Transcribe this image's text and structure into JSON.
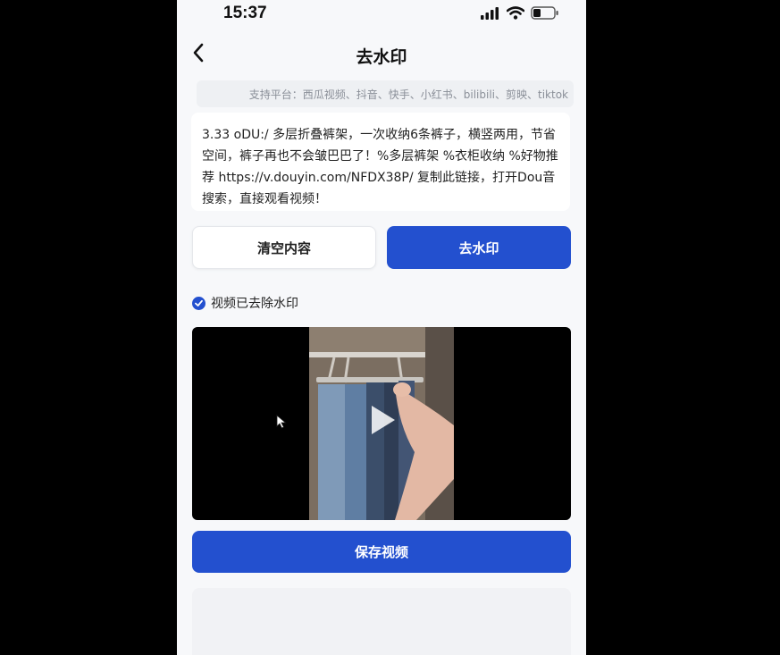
{
  "status_bar": {
    "time": "15:37",
    "icons": [
      "signal-icon",
      "wifi-icon",
      "battery-icon"
    ],
    "battery_level": 0.3
  },
  "navbar": {
    "back_icon": "chevron-left-icon",
    "title": "去水印"
  },
  "platforms_text": "支持平台：西瓜视频、抖音、快手、小红书、bilibili、剪映、tiktok",
  "input": {
    "value": "3.33 oDU:/ 多层折叠裤架，一次收纳6条裤子，横竖两用，节省空间，裤子再也不会皱巴巴了！%多层裤架 %衣柜收纳 %好物推荐 https://v.douyin.com/NFDX38P/ 复制此链接，打开Dou音搜索，直接观看视频！"
  },
  "actions": {
    "clear_label": "清空内容",
    "remove_label": "去水印"
  },
  "result": {
    "status_text": "视频已去除水印",
    "status_icon": "check-circle-icon",
    "play_icon": "play-icon"
  },
  "save_label": "保存视频",
  "colors": {
    "accent": "#2350cf",
    "background": "#f7f8fa",
    "text": "#222222"
  }
}
